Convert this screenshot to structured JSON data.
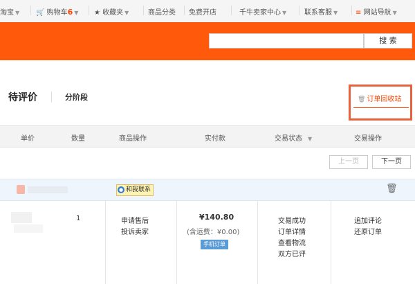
{
  "topnav": {
    "taobao": "淘宝",
    "cart": "购物车",
    "cart_count": "6",
    "favorites": "收藏夹",
    "categories": "商品分类",
    "open_shop": "免费开店",
    "seller_center": "千牛卖家中心",
    "customer_service": "联系客服",
    "site_nav": "网站导航"
  },
  "search": {
    "button": "搜 索",
    "placeholder": ""
  },
  "tabs": {
    "pending_review": "待评价",
    "staged": "分阶段",
    "recycle_bin": "订单回收站"
  },
  "table_header": {
    "unit_price": "单价",
    "quantity": "数量",
    "product_action": "商品操作",
    "paid": "实付款",
    "status": "交易状态",
    "trade_action": "交易操作"
  },
  "pager": {
    "prev": "上一页",
    "next": "下一页"
  },
  "order": {
    "contact": "和我联系",
    "unit_price": "",
    "quantity": "1",
    "product_actions": [
      "申请售后",
      "投诉卖家"
    ],
    "price": "¥140.80",
    "freight": "(含运费：¥0.00)",
    "mobile_tag": "手机订单",
    "status_lines": [
      "交易成功",
      "订单详情",
      "查看物流",
      "双方已评"
    ],
    "trade_actions": [
      "追加评论",
      "还原订单"
    ]
  }
}
